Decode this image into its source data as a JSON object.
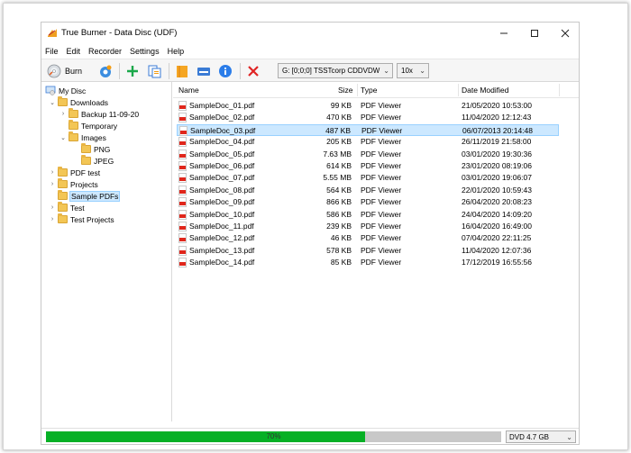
{
  "window": {
    "title": "True Burner - Data Disc (UDF)"
  },
  "menu": [
    "File",
    "Edit",
    "Recorder",
    "Settings",
    "Help"
  ],
  "toolbar": {
    "burn_label": "Burn",
    "drive": "G: [0;0;0] TSSTcorp CDDVDW",
    "speed": "10x"
  },
  "tree": [
    {
      "label": "My Disc",
      "level": 0,
      "type": "disc",
      "exp": ""
    },
    {
      "label": "Downloads",
      "level": 1,
      "type": "folder",
      "exp": "v"
    },
    {
      "label": "Backup 11-09-20",
      "level": 2,
      "type": "folder",
      "exp": ">"
    },
    {
      "label": "Temporary",
      "level": 2,
      "type": "folder",
      "exp": ""
    },
    {
      "label": "Images",
      "level": 2,
      "type": "folder",
      "exp": "v"
    },
    {
      "label": "PNG",
      "level": 3,
      "type": "folder",
      "exp": ""
    },
    {
      "label": "JPEG",
      "level": 3,
      "type": "folder",
      "exp": ""
    },
    {
      "label": "PDF test",
      "level": 1,
      "type": "folder",
      "exp": ">"
    },
    {
      "label": "Projects",
      "level": 1,
      "type": "folder",
      "exp": ">"
    },
    {
      "label": "Sample PDFs",
      "level": 1,
      "type": "folder",
      "exp": "",
      "selected": true
    },
    {
      "label": "Test",
      "level": 1,
      "type": "folder",
      "exp": ">"
    },
    {
      "label": "Test Projects",
      "level": 1,
      "type": "folder",
      "exp": ">"
    }
  ],
  "columns": {
    "name": "Name",
    "size": "Size",
    "type": "Type",
    "modified": "Date Modified"
  },
  "files": [
    {
      "name": "SampleDoc_01.pdf",
      "size": "99 KB",
      "type": "PDF Viewer",
      "modified": "21/05/2020 10:53:00"
    },
    {
      "name": "SampleDoc_02.pdf",
      "size": "470 KB",
      "type": "PDF Viewer",
      "modified": "11/04/2020 12:12:43"
    },
    {
      "name": "SampleDoc_03.pdf",
      "size": "487 KB",
      "type": "PDF Viewer",
      "modified": "06/07/2013 20:14:48",
      "selected": true
    },
    {
      "name": "SampleDoc_04.pdf",
      "size": "205 KB",
      "type": "PDF Viewer",
      "modified": "26/11/2019 21:58:00"
    },
    {
      "name": "SampleDoc_05.pdf",
      "size": "7.63 MB",
      "type": "PDF Viewer",
      "modified": "03/01/2020 19:30:36"
    },
    {
      "name": "SampleDoc_06.pdf",
      "size": "614 KB",
      "type": "PDF Viewer",
      "modified": "23/01/2020 08:19:06"
    },
    {
      "name": "SampleDoc_07.pdf",
      "size": "5.55 MB",
      "type": "PDF Viewer",
      "modified": "03/01/2020 19:06:07"
    },
    {
      "name": "SampleDoc_08.pdf",
      "size": "564 KB",
      "type": "PDF Viewer",
      "modified": "22/01/2020 10:59:43"
    },
    {
      "name": "SampleDoc_09.pdf",
      "size": "866 KB",
      "type": "PDF Viewer",
      "modified": "26/04/2020 20:08:23"
    },
    {
      "name": "SampleDoc_10.pdf",
      "size": "586 KB",
      "type": "PDF Viewer",
      "modified": "24/04/2020 14:09:20"
    },
    {
      "name": "SampleDoc_11.pdf",
      "size": "239 KB",
      "type": "PDF Viewer",
      "modified": "16/04/2020 16:49:00"
    },
    {
      "name": "SampleDoc_12.pdf",
      "size": "46 KB",
      "type": "PDF Viewer",
      "modified": "07/04/2020 22:11:25"
    },
    {
      "name": "SampleDoc_13.pdf",
      "size": "578 KB",
      "type": "PDF Viewer",
      "modified": "11/04/2020 12:07:36"
    },
    {
      "name": "SampleDoc_14.pdf",
      "size": "85 KB",
      "type": "PDF Viewer",
      "modified": "17/12/2019 16:55:56"
    }
  ],
  "status": {
    "progress_text": "70%",
    "progress_value": 0.7,
    "disc_type": "DVD 4.7 GB"
  },
  "colors": {
    "progress_fill": "#06b025",
    "selection": "#cce8ff",
    "folder": "#f3c655"
  }
}
